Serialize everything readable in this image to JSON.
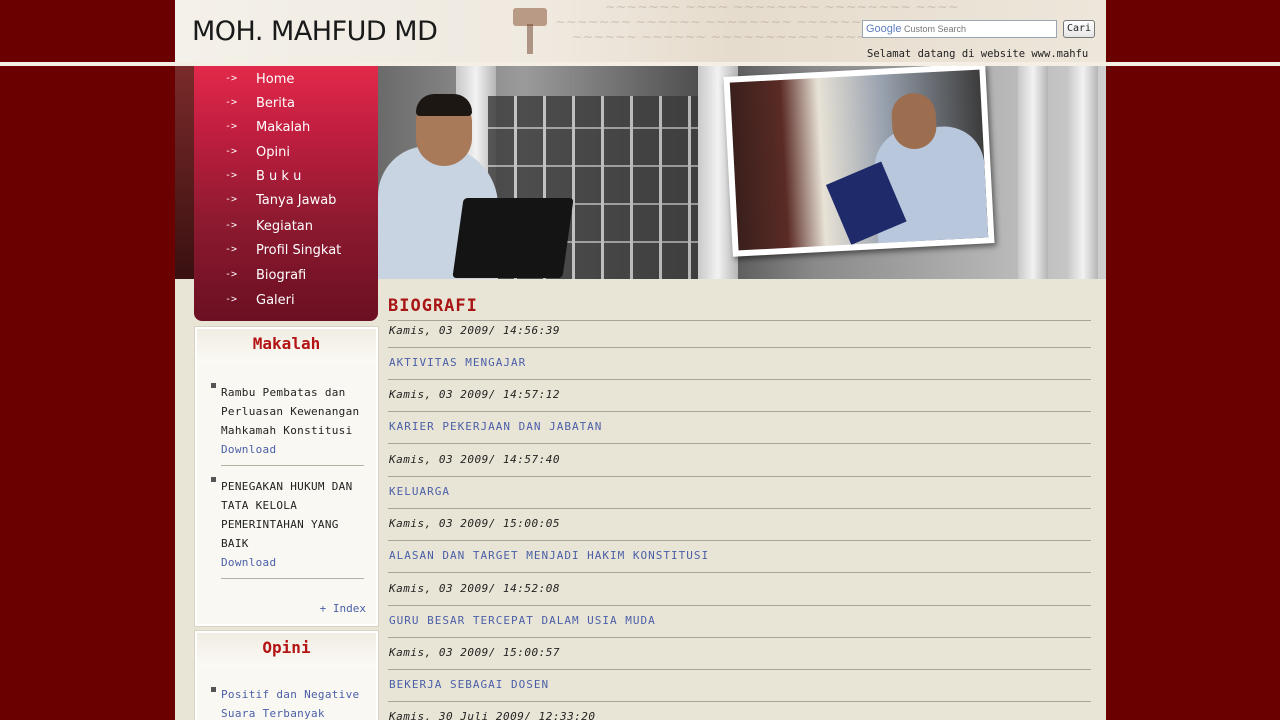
{
  "header": {
    "site_title": "MOH. MAHFUD MD",
    "search_placeholder": "Custom Search",
    "search_brand": "Google",
    "search_button": "Cari",
    "welcome": "Selamat datang di website www.mahfu"
  },
  "menu": {
    "items": [
      {
        "label": "Home"
      },
      {
        "label": "Berita"
      },
      {
        "label": "Makalah"
      },
      {
        "label": "Opini"
      },
      {
        "label": "B u k u"
      },
      {
        "label": "Tanya Jawab"
      },
      {
        "label": "Kegiatan"
      },
      {
        "label": "Profil Singkat"
      },
      {
        "label": "Biografi"
      },
      {
        "label": "Galeri"
      }
    ]
  },
  "makalah": {
    "title": "Makalah",
    "items": [
      {
        "text": "Rambu Pembatas dan Perluasan Kewenangan Mahkamah Konstitusi",
        "link": "Download"
      },
      {
        "text": "PENEGAKAN HUKUM DAN TATA KELOLA PEMERINTAHAN YANG BAIK",
        "link": "Download"
      }
    ],
    "index": "+ Index"
  },
  "opini": {
    "title": "Opini",
    "items": [
      {
        "text": "Positif dan Negative Suara Terbanyak"
      }
    ]
  },
  "content": {
    "title": "BIOGRAFI",
    "entries": [
      {
        "date": "Kamis, 03 2009/ 14:56:39",
        "title": "AKTIVITAS MENGAJAR"
      },
      {
        "date": "Kamis, 03 2009/ 14:57:12",
        "title": "KARIER PEKERJAAN DAN JABATAN"
      },
      {
        "date": "Kamis, 03 2009/ 14:57:40",
        "title": "KELUARGA"
      },
      {
        "date": "Kamis, 03 2009/ 15:00:05",
        "title": "ALASAN DAN TARGET MENJADI HAKIM KONSTITUSI"
      },
      {
        "date": "Kamis, 03 2009/ 14:52:08",
        "title": "GURU BESAR TERCEPAT DALAM USIA MUDA"
      },
      {
        "date": "Kamis, 03 2009/ 15:00:57",
        "title": "BEKERJA SEBAGAI DOSEN"
      },
      {
        "date": "Kamis, 30 Juli 2009/ 12:33:20",
        "title": ""
      }
    ]
  },
  "colors": {
    "background": "#6b0000",
    "menu_red": "#c21e40",
    "heading_red": "#a81515",
    "link_blue": "#4a5fa8"
  }
}
